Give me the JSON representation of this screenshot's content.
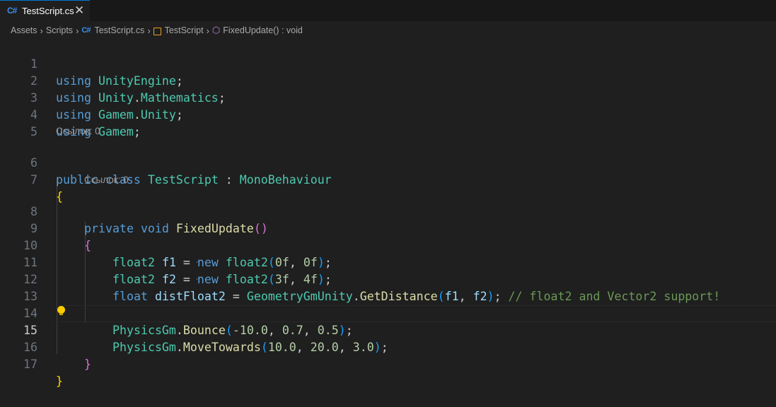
{
  "tab": {
    "icon": "csharp-file-icon",
    "icon_text": "C#",
    "title": "TestScript.cs",
    "close": "✕"
  },
  "breadcrumb": {
    "items": [
      "Assets",
      "Scripts",
      "TestScript.cs",
      "TestScript",
      "FixedUpdate() : void"
    ],
    "separator": "›",
    "cs_icon_text": "C#",
    "method_icon": "⬡"
  },
  "editor": {
    "active_line": 15,
    "lines": [
      {
        "n": "1"
      },
      {
        "n": "2"
      },
      {
        "n": "3"
      },
      {
        "n": "4"
      },
      {
        "n": "5"
      },
      {
        "n": "6",
        "lens": "Ссылок: 0"
      },
      {
        "n": "7"
      },
      {
        "n": "8",
        "lens": "Ссылок: 0"
      },
      {
        "n": "9"
      },
      {
        "n": "10"
      },
      {
        "n": "11"
      },
      {
        "n": "12"
      },
      {
        "n": "13"
      },
      {
        "n": "14"
      },
      {
        "n": "15"
      },
      {
        "n": "16"
      },
      {
        "n": "17"
      }
    ],
    "tokens": {
      "l1": [
        "using",
        " ",
        "UnityEngine",
        ";"
      ],
      "l2": [
        "using",
        " ",
        "Unity",
        ".",
        "Mathematics",
        ";"
      ],
      "l3": [
        "using",
        " ",
        "Gamem",
        ".",
        "Unity",
        ";"
      ],
      "l4": [
        "using",
        " ",
        "Gamem",
        ";"
      ],
      "l6": [
        "public",
        " ",
        "class",
        " ",
        "TestScript",
        " : ",
        "MonoBehaviour"
      ],
      "l7": [
        "{"
      ],
      "l8": [
        "private",
        " ",
        "void",
        " ",
        "FixedUpdate",
        "(",
        ")"
      ],
      "l9": [
        "{"
      ],
      "l10": [
        "float2",
        " ",
        "f1",
        " = ",
        "new",
        " ",
        "float2",
        "(",
        "0f",
        ", ",
        "0f",
        ")",
        ";"
      ],
      "l11": [
        "float2",
        " ",
        "f2",
        " = ",
        "new",
        " ",
        "float2",
        "(",
        "3f",
        ", ",
        "4f",
        ")",
        ";"
      ],
      "l12": [
        "float",
        " ",
        "distFloat2",
        " = ",
        "GeometryGmUnity",
        ".",
        "GetDistance",
        "(",
        "f1",
        ", ",
        "f2",
        ")",
        "; ",
        "// float2 and Vector2 support!"
      ],
      "l14": [
        "PhysicsGm",
        ".",
        "Bounce",
        "(",
        "-10.0",
        ", ",
        "0.7",
        ", ",
        "0.5",
        ")",
        ";"
      ],
      "l15": [
        "PhysicsGm",
        ".",
        "MoveTowards",
        "(",
        "10.0",
        ", ",
        "20.0",
        ", ",
        "3.0",
        ")",
        ";"
      ],
      "l16": [
        "}"
      ],
      "l17": [
        "}"
      ]
    },
    "lightbulb_icon": "lightbulb-icon"
  },
  "colors": {
    "background": "#1f1f1f",
    "keyword": "#569cd6",
    "type": "#4ec9b0",
    "function": "#dcdcaa",
    "number": "#b5cea8",
    "variable": "#9cdcfe",
    "comment": "#6a9955",
    "bracket_level1": "#ffd700",
    "bracket_level2": "#da70d6",
    "bracket_level3": "#179fff"
  }
}
